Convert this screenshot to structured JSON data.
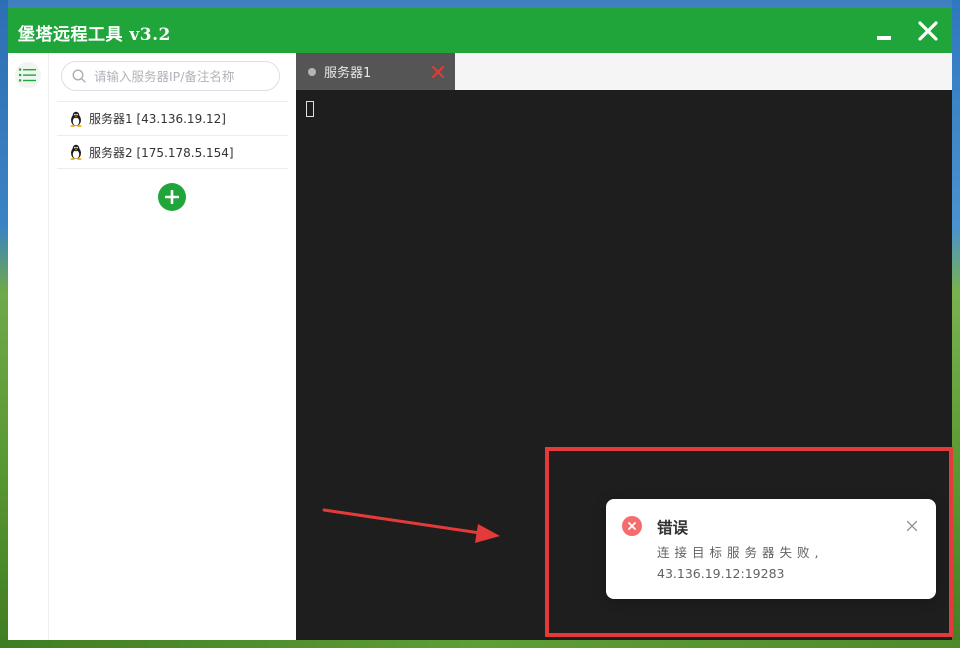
{
  "window": {
    "title": "堡塔远程工具  v3.2"
  },
  "search": {
    "placeholder": "请输入服务器IP/备注名称"
  },
  "servers": [
    {
      "label": "服务器1 [43.136.19.12]"
    },
    {
      "label": "服务器2 [175.178.5.154]"
    }
  ],
  "tabs": [
    {
      "label": "服务器1"
    }
  ],
  "notification": {
    "title": "错误",
    "message_line1": "连接目标服务器失败,",
    "message_line2": "43.136.19.12:19283"
  },
  "colors": {
    "brand_green": "#20a53a",
    "terminal_bg": "#1e1e1e",
    "error_red": "#f56c6c",
    "annotation_red": "#e53a3a",
    "tab_close_red": "#e53935"
  },
  "icons": {
    "list": "list-icon",
    "search": "search-icon",
    "linux": "tux-icon",
    "add": "plus-icon",
    "minimize": "minimize-icon",
    "close": "close-icon",
    "error": "error-icon"
  }
}
